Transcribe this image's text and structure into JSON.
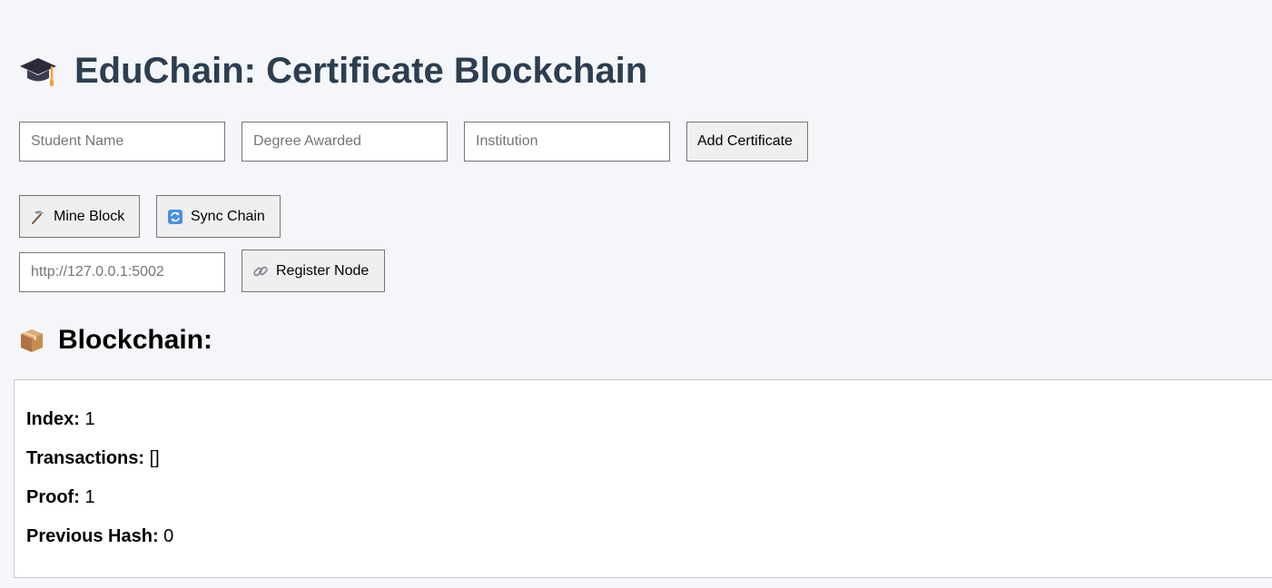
{
  "header": {
    "title": "EduChain: Certificate Blockchain",
    "icon": "graduation-cap-icon"
  },
  "form": {
    "student_name_placeholder": "Student Name",
    "degree_placeholder": "Degree Awarded",
    "institution_placeholder": "Institution",
    "add_button_label": "Add Certificate"
  },
  "actions": {
    "mine_label": "Mine Block",
    "mine_icon": "pickaxe-icon",
    "sync_label": "Sync Chain",
    "sync_icon": "sync-icon"
  },
  "node": {
    "url_placeholder": "http://127.0.0.1:5002",
    "register_label": "Register Node",
    "register_icon": "link-icon"
  },
  "chain": {
    "heading": "Blockchain:",
    "heading_icon": "package-icon",
    "blocks": [
      {
        "index_label": "Index:",
        "index_value": "1",
        "transactions_label": "Transactions:",
        "transactions_value": "[]",
        "proof_label": "Proof:",
        "proof_value": "1",
        "previous_hash_label": "Previous Hash:",
        "previous_hash_value": "0"
      }
    ]
  },
  "colors": {
    "background": "#f4f6f9",
    "title": "#2c3e50",
    "button_bg": "#efefef",
    "border": "#767676"
  }
}
